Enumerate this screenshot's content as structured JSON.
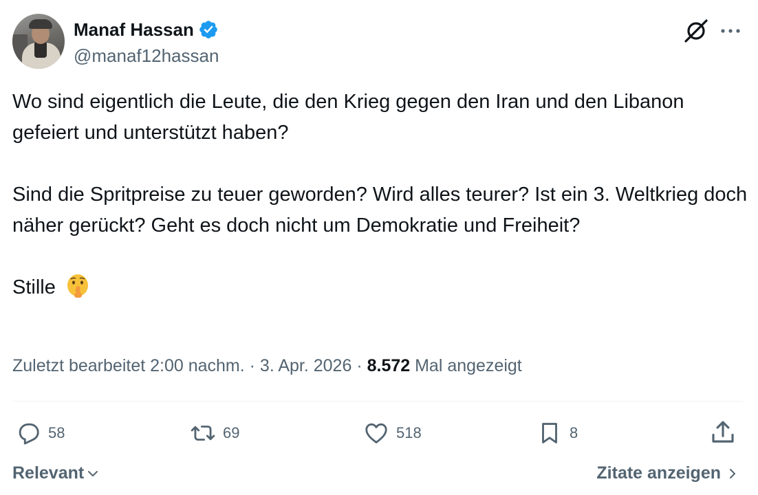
{
  "author": {
    "display_name": "Manaf Hassan",
    "handle": "@manaf12hassan",
    "verified_color": "#1d9bf0"
  },
  "tweet": {
    "paragraphs": [
      "Wo sind eigentlich die Leute, die den Krieg gegen den Iran und den Libanon gefeiert und unterstützt haben?",
      "Sind die Spritpreise zu teuer geworden? Wird alles teurer? Ist ein 3. Weltkrieg doch näher gerückt? Geht es doch nicht um Demokratie und Freiheit?"
    ],
    "closing": "Stille",
    "closing_emoji": "shushing-face"
  },
  "meta": {
    "edited_prefix": "Zuletzt bearbeitet 2:00 nachm.",
    "sep1": " · ",
    "date": "3. Apr. 2026",
    "sep2": " · ",
    "views": "8.572",
    "views_label": " Mal angezeigt"
  },
  "actions": {
    "replies": "58",
    "reposts": "69",
    "likes": "518",
    "bookmarks": "8"
  },
  "footer": {
    "sort_label": "Relevant",
    "quotes_label": "Zitate anzeigen"
  },
  "icons": [
    "verified-badge-icon",
    "grok-icon",
    "more-icon",
    "reply-icon",
    "repost-icon",
    "like-icon",
    "bookmark-icon",
    "share-icon",
    "chevron-down-icon",
    "chevron-right-icon"
  ]
}
